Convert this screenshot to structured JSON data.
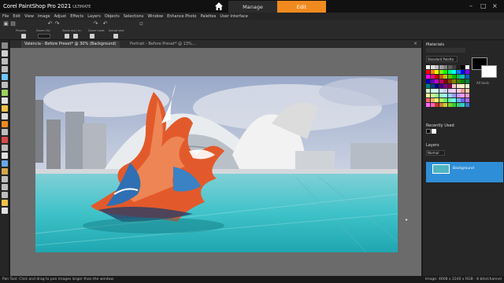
{
  "app": {
    "brand": "Corel PaintShop Pro 2021",
    "edition": "ULTIMATE",
    "tabs": {
      "manage": "Manage",
      "edit": "Edit"
    },
    "accent": "#f08a1e"
  },
  "menu": [
    "File",
    "Edit",
    "View",
    "Image",
    "Adjust",
    "Effects",
    "Layers",
    "Objects",
    "Selections",
    "Window",
    "Enhance Photo",
    "Palettes",
    "User Interface"
  ],
  "tool_options": {
    "labels": [
      "Presets:",
      "Zoom (%):",
      "Zoom out / in:",
      "Zoom more:",
      "Actual size:"
    ]
  },
  "document": {
    "tabs": [
      {
        "label": "Valencia - Before Preset* @ 30% (Background)"
      },
      {
        "label": "Portrait - Before Preset* @ 13%..."
      }
    ]
  },
  "materials": {
    "title": "Materials",
    "palette_select": "Standard Palette",
    "all_tools_label": "All tools",
    "recently_used": "Recently Used"
  },
  "layers": {
    "title": "Layers",
    "blend_mode": "Normal",
    "layer_name": "Background"
  },
  "status": {
    "left": "Pan Tool: Click and drag to pan images larger than the window.",
    "right": "Image: 4608 x 2240 x RGB - 8 bits/channel"
  },
  "icons": {
    "home": "home-icon",
    "minimize": "minimize-icon",
    "maximize": "maximize-icon",
    "close": "close-icon"
  }
}
